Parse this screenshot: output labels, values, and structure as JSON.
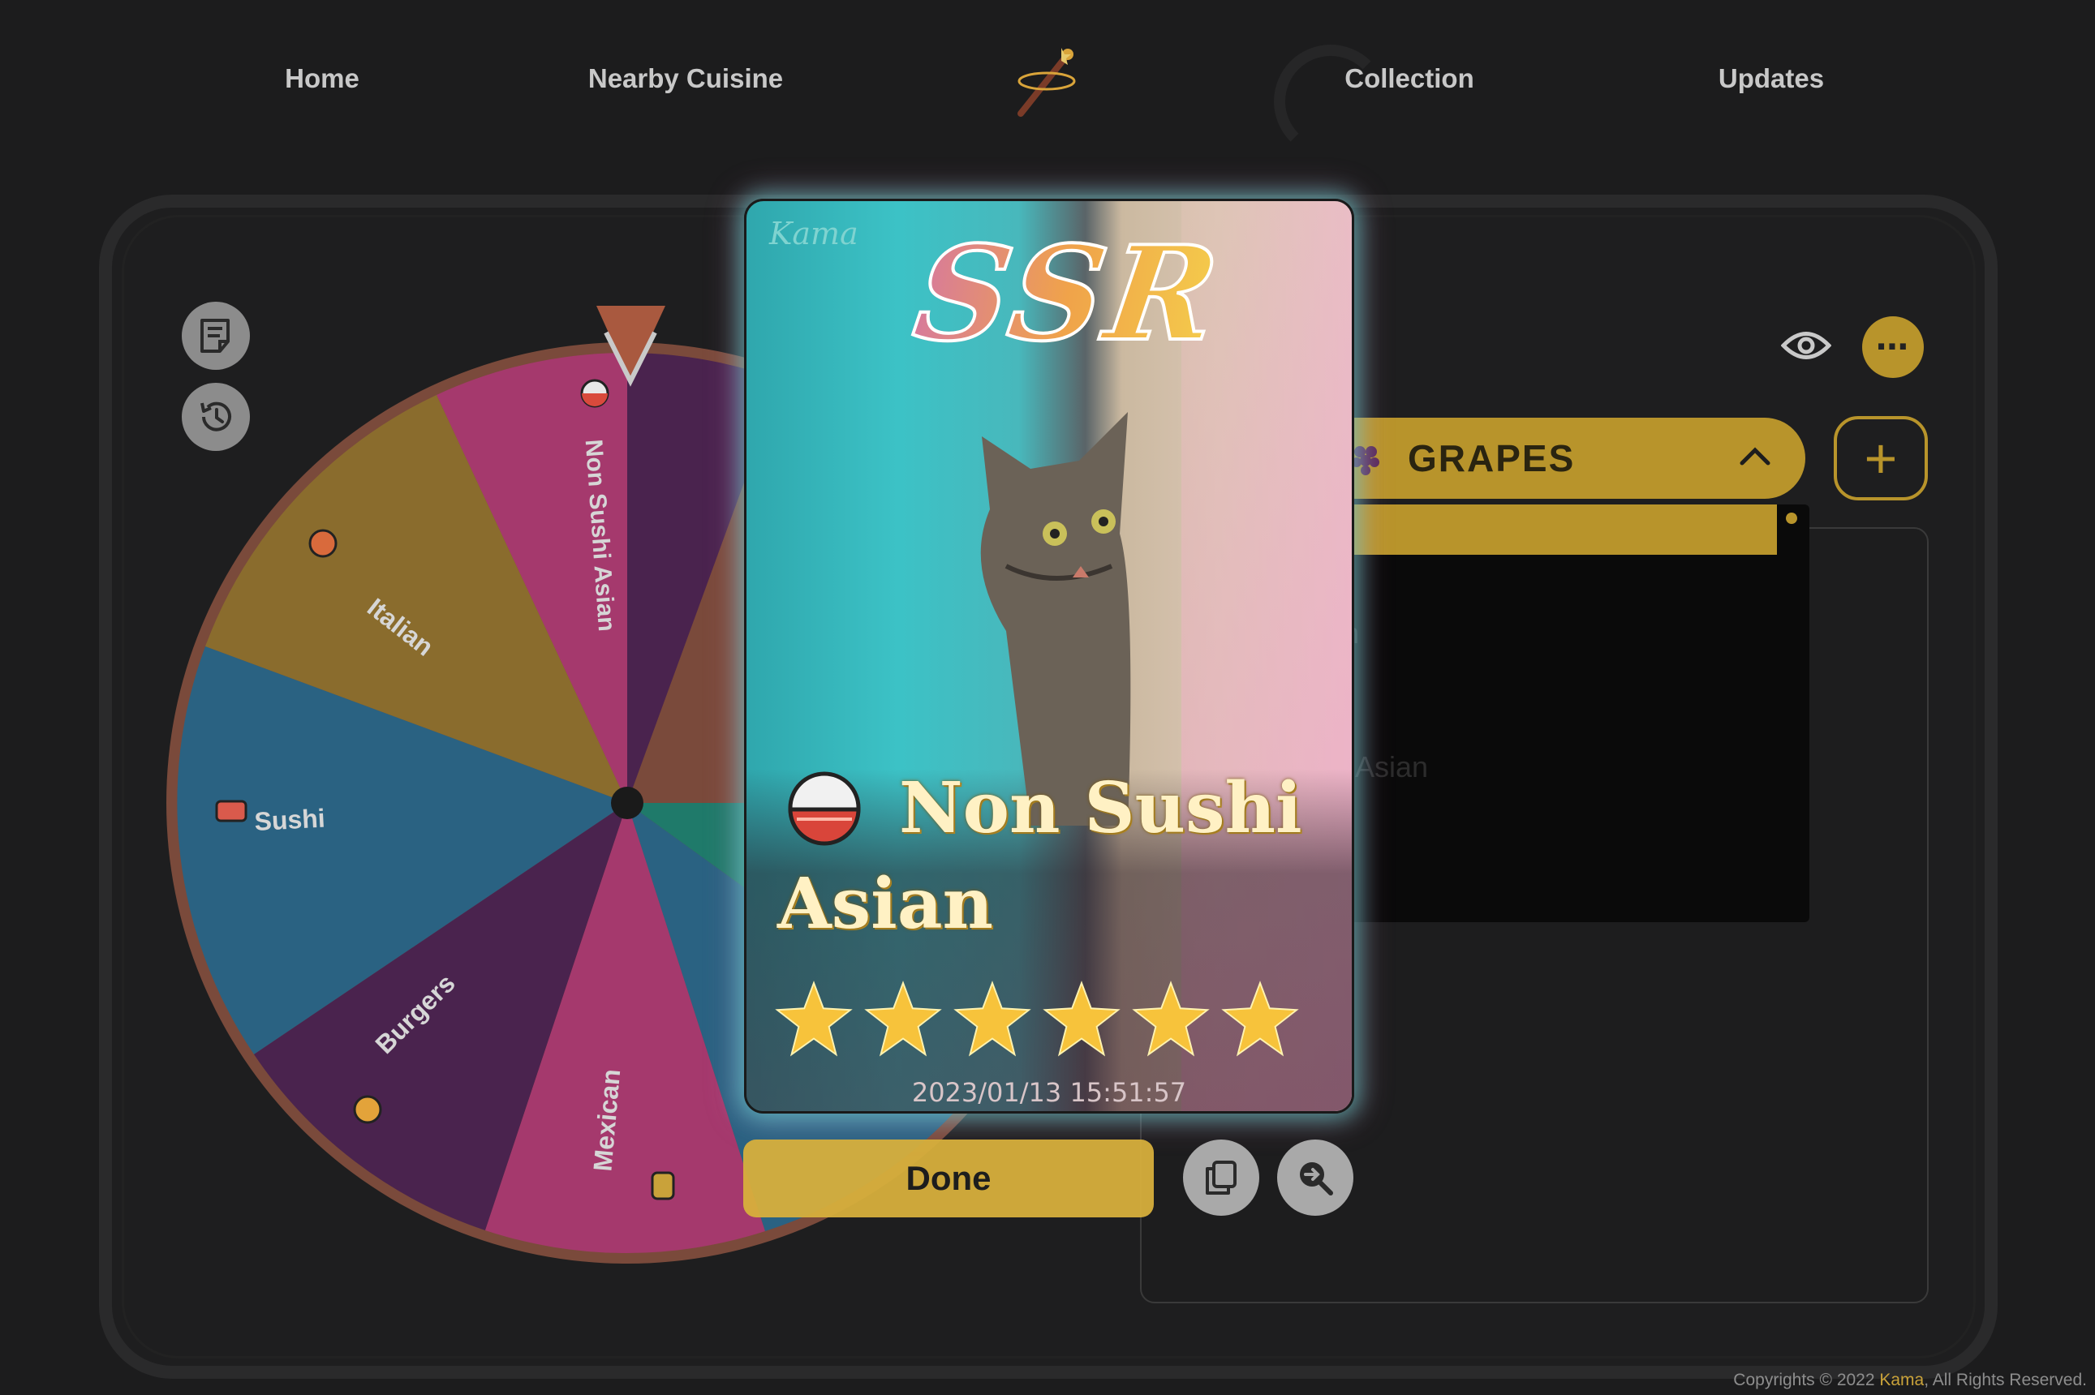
{
  "nav": {
    "items": [
      "Home",
      "Nearby Cuisine",
      "Collection",
      "Updates"
    ]
  },
  "wheel": {
    "segments": [
      {
        "label": "Non Sushi Asian",
        "color": "#a5396d"
      },
      {
        "label": "Italian",
        "color": "#8a6c2d"
      },
      {
        "label": "Sushi",
        "color": "#2a6282"
      },
      {
        "label": "Burgers",
        "color": "#4a234e"
      },
      {
        "label": "Mexican",
        "color": "#a5396d"
      }
    ],
    "rim_color": "#7a4a3b"
  },
  "panel": {
    "group_label": "GRAPES",
    "add_label": "+",
    "more_label": "⋯",
    "faint_items": [
      "n",
      "Asian"
    ]
  },
  "card": {
    "watermark": "Kama",
    "rarity": "SSR",
    "name": "Non Sushi Asian",
    "stars": 6,
    "date": "2023/01/13 15:51:57"
  },
  "actions": {
    "done_label": "Done"
  },
  "footer": {
    "prefix": "Copyrights © 2022 ",
    "brand": "Kama",
    "suffix": ", All Rights Reserved."
  },
  "colors": {
    "accent": "#b8942b",
    "background": "#1c1c1d"
  }
}
